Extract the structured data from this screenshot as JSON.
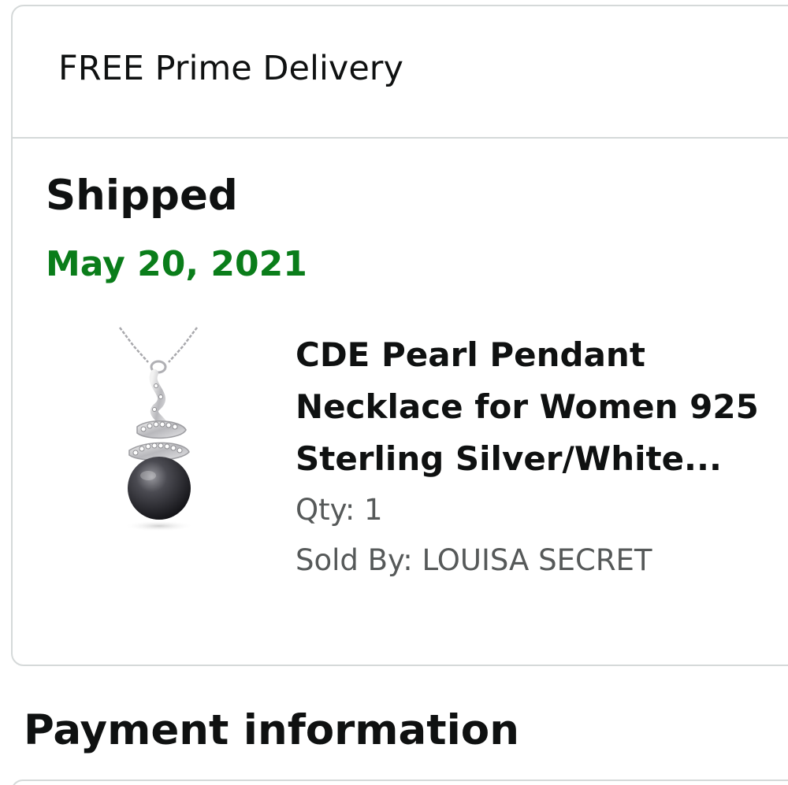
{
  "shipment": {
    "delivery_label": "FREE Prime Delivery",
    "status": "Shipped",
    "date": "May 20, 2021",
    "date_color": "#0a7d1a"
  },
  "product": {
    "title": "CDE Pearl Pendant Necklace for Women 925 Sterling Silver/White...",
    "qty": "Qty: 1",
    "sold_by": "Sold By: LOUISA SECRET",
    "image_icon": "pearl-pendant-necklace-image"
  },
  "payment": {
    "heading": "Payment information"
  }
}
